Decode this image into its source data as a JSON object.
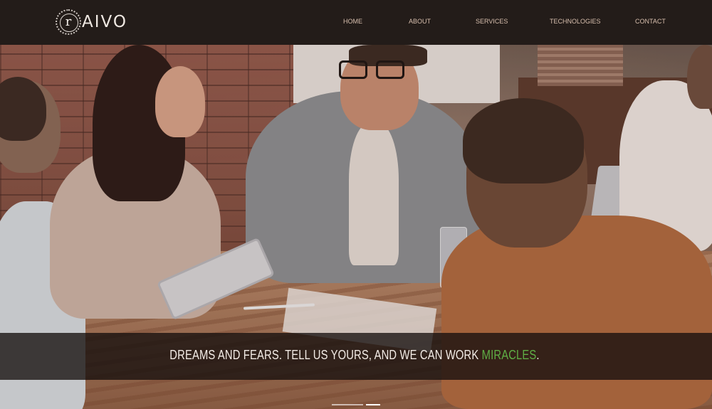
{
  "brand": {
    "logo_letter": "r",
    "name": "AIVO"
  },
  "nav": {
    "items": [
      {
        "label": "HOME"
      },
      {
        "label": "ABOUT"
      },
      {
        "label": "SERVICES"
      },
      {
        "label": "TECHNOLOGIES"
      },
      {
        "label": "CONTACT"
      }
    ]
  },
  "hero": {
    "caption_prefix": "DREAMS AND FEARS. TELL US YOURS, AND WE CAN WORK ",
    "caption_accent": "MIRACLES",
    "caption_suffix": ".",
    "slides": {
      "count": 2,
      "active_index": 1
    }
  },
  "colors": {
    "header_bg": "#231c19",
    "nav_text": "#d8bfae",
    "accent_green": "#5fae45",
    "caption_bg": "#16100e"
  },
  "icons": [
    "logo-badge-icon"
  ]
}
